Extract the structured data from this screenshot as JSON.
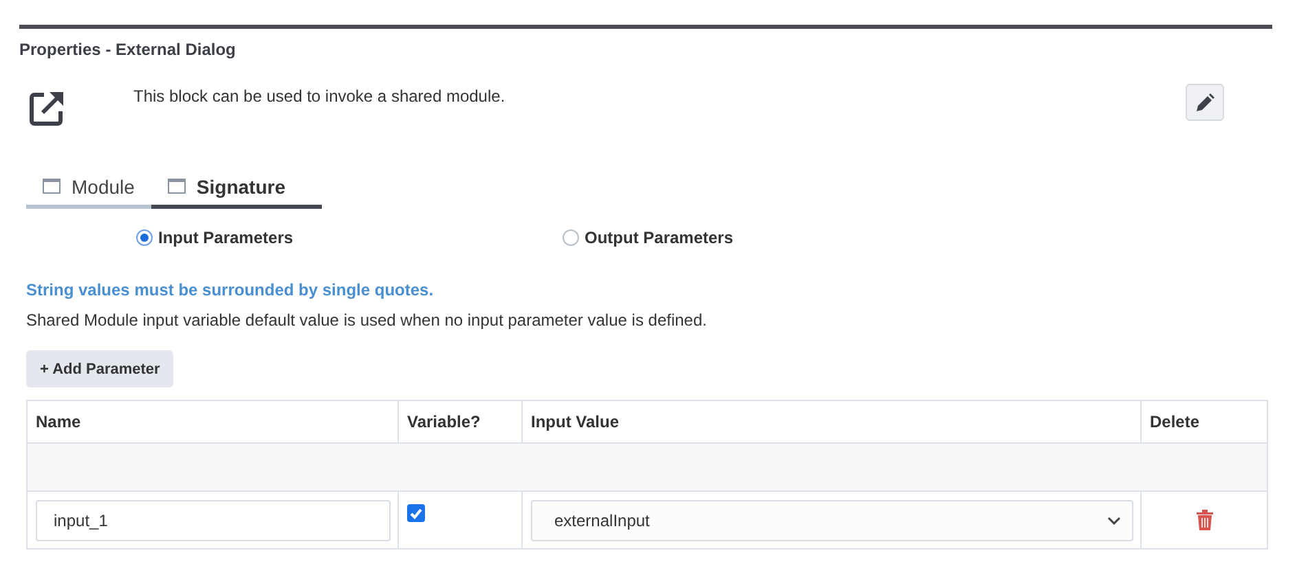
{
  "panel": {
    "title": "Properties - External Dialog",
    "description": "This block can be used to invoke a shared module."
  },
  "tabs": [
    {
      "label": "Module",
      "selected": false
    },
    {
      "label": "Signature",
      "selected": true
    }
  ],
  "radios": [
    {
      "label": "Input Parameters",
      "selected": true
    },
    {
      "label": "Output Parameters",
      "selected": false
    }
  ],
  "notes": {
    "warning": "String values must be surrounded by single quotes.",
    "info": "Shared Module input variable default value is used when no input parameter value is defined."
  },
  "add_button": "+ Add Parameter",
  "table": {
    "columns": [
      "Name",
      "Variable?",
      "Input Value",
      "Delete"
    ],
    "rows": [
      {
        "name": "input_1",
        "variable": true,
        "input_value": "externalInput"
      }
    ]
  }
}
